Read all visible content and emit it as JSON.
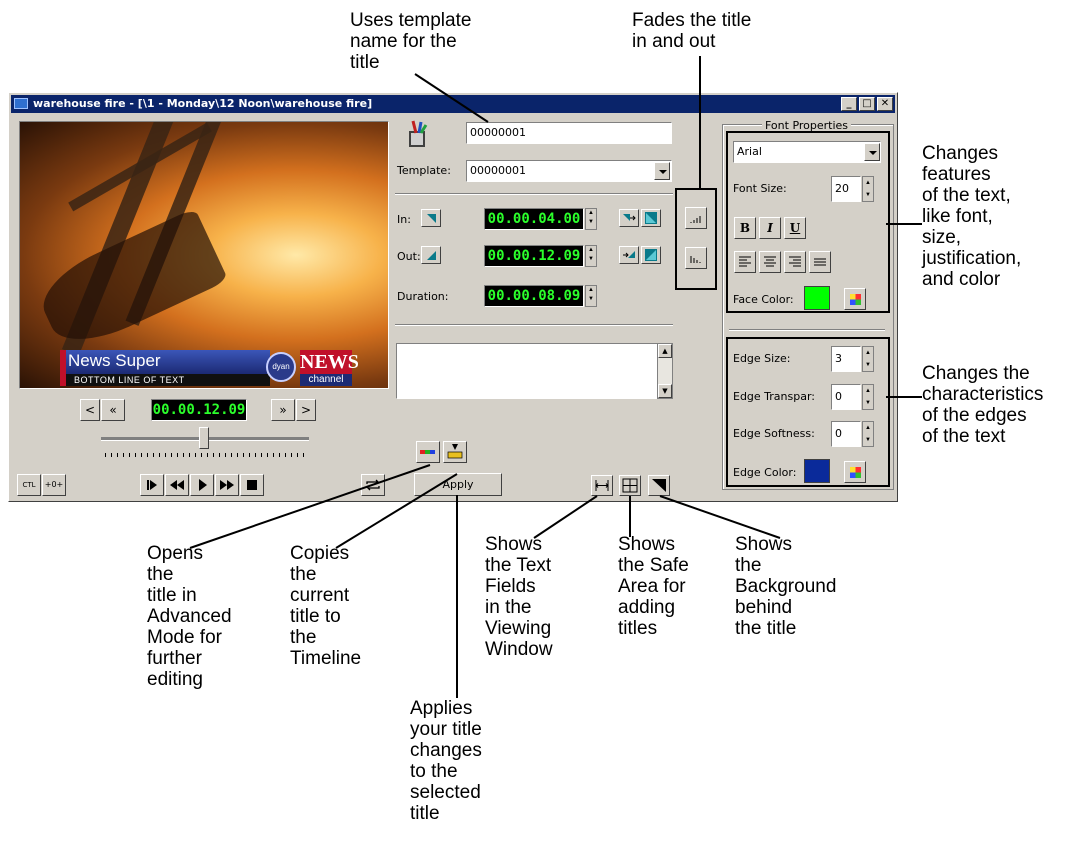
{
  "window": {
    "title": "warehouse fire - [\\1 - Monday\\12 Noon\\warehouse fire]",
    "minimize_glyph": "_",
    "maximize_glyph": "□",
    "close_glyph": "✕"
  },
  "video": {
    "lower_third_main": "News Super",
    "lower_third_sub": "BOTTOM LINE OF TEXT",
    "logo_text": "dyan",
    "network_text": "NEWS",
    "network_sub": "channel"
  },
  "title_panel": {
    "name_value": "00000001",
    "template_label": "Template:",
    "template_value": "00000001",
    "in_label": "In:",
    "in_timecode": "00.00.04.00",
    "out_label": "Out:",
    "out_timecode": "00.00.12.09",
    "duration_label": "Duration:",
    "duration_timecode": "00.00.08.09"
  },
  "transport": {
    "timecode": "00.00.12.09",
    "step_back": "<",
    "rewind_fast": "«",
    "forward_fast": "»",
    "step_forward": ">",
    "ctl_label": "CTL",
    "apply_label": "Apply"
  },
  "font_properties": {
    "group_label": "Font Properties",
    "font_value": "Arial",
    "font_size_label": "Font Size:",
    "font_size_value": "20",
    "bold": "B",
    "italic": "I",
    "underline": "U",
    "face_color_label": "Face Color:",
    "face_color": "#00ff00"
  },
  "edge_properties": {
    "edge_size_label": "Edge Size:",
    "edge_size_value": "3",
    "edge_transpar_label": "Edge Transpar:",
    "edge_transpar_value": "0",
    "edge_softness_label": "Edge Softness:",
    "edge_softness_value": "0",
    "edge_color_label": "Edge Color:",
    "edge_color": "#0a2a9a"
  },
  "callouts": {
    "template_name": "Uses template\nname for the\ntitle",
    "fades": "Fades the title\nin and out",
    "font_features": "Changes\nfeatures\nof the text,\nlike font,\nsize,\njustification,\nand color",
    "edges": "Changes the\ncharacteristics\nof the edges\nof the text",
    "advanced_mode": "Opens\nthe\ntitle in\nAdvanced\nMode for\nfurther\nediting",
    "copies_timeline": "Copies\nthe\ncurrent\ntitle to\nthe\nTimeline",
    "applies": "Applies\nyour title\nchanges\nto the\nselected\ntitle",
    "text_fields": "Shows\nthe Text\nFields\nin the\nViewing\nWindow",
    "safe_area": "Shows\nthe Safe\nArea for\nadding\ntitles",
    "background": "Shows\nthe\nBackground\nbehind\nthe title"
  }
}
